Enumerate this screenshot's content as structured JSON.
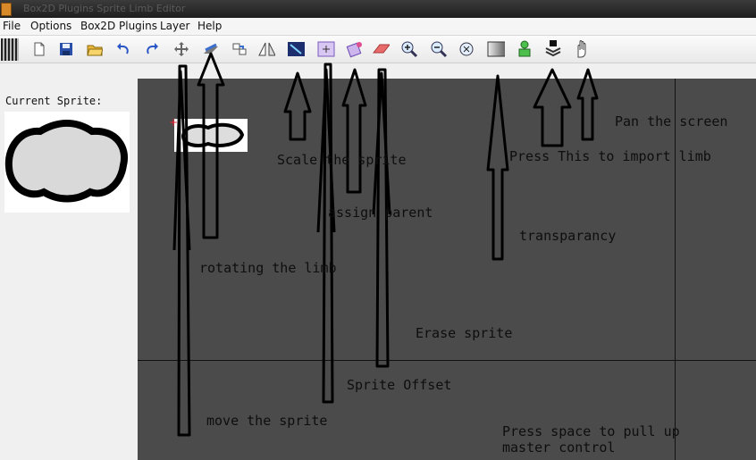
{
  "window": {
    "title": "Box2D Plugins Sprite Limb Editor"
  },
  "menu": {
    "items": [
      "File",
      "Options",
      "Box2D Plugins",
      "Layer",
      "Help"
    ]
  },
  "toolbar": {
    "tools": [
      "new-document",
      "save",
      "open-folder",
      "undo",
      "redo",
      "move",
      "rotate",
      "link",
      "mirror",
      "scale",
      "sprite-offset",
      "assign-parent",
      "eraser",
      "zoom-in",
      "zoom-out",
      "zoom-fit",
      "transparency",
      "import-limb",
      "import-stack",
      "pan-hand"
    ]
  },
  "sidebar": {
    "current_sprite_label": "Current Sprite:"
  },
  "annotations": {
    "pan_screen": "Pan the screen",
    "scale_sprite": "Scale the sprite",
    "import_limb": "Press This to import limb",
    "assign_parent": "assign parent",
    "transparency": "transparancy",
    "rotating_limb": "rotating the limb",
    "erase_sprite": "Erase sprite",
    "sprite_offset": "Sprite Offset",
    "move_sprite": "move the sprite",
    "master_control_line1": "Press space to pull up",
    "master_control_line2": "master control"
  },
  "colors": {
    "canvas": "#4b4b4b",
    "panel": "#f0f0f0",
    "accent_arrow": "#000000",
    "eraser": "#e86a6a"
  }
}
